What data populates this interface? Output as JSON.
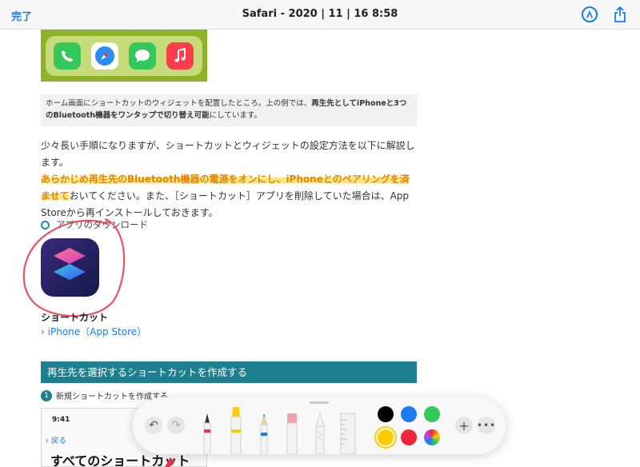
{
  "topbar": {
    "done_label": "完了",
    "title": "Safari - 2020 | 11 | 16 8:58",
    "markup_icon": "markup-pen-icon",
    "share_icon": "share-icon"
  },
  "hero": {
    "apps": [
      "phone-icon",
      "safari-icon",
      "messages-icon",
      "music-icon"
    ]
  },
  "caption": {
    "text_1": "ホーム画面にショートカットのウィジェットを配置したところ。上の例では、",
    "bold": "再生先としてiPhoneと3つのBluetooth機器をワンタップで切り替え可能",
    "text_2": "にしています。"
  },
  "article": {
    "para_1": "少々長い手順になりますが、ショートカットとウィジェットの設定方法を以下に解説します。",
    "highlight": "あらかじめ再生先のBluetooth機器の電源をオンにし、iPhoneとのペアリングを済ませて",
    "para_2": "おいてください。また、［ショートカット］アプリを削除していた場合は、App Storeから再インストールしておきます。",
    "download_label": "アプリのダウンロード",
    "app_name": "ショートカット",
    "store_link": "iPhone（App Store）",
    "section_title": "再生先を選択するショートカットを作成する",
    "step_number": "1",
    "step_text": "新規ショートカットを作成する",
    "screenshot": {
      "time": "9:41",
      "back_label": "戻る",
      "title": "すべてのショートカット"
    }
  },
  "toolbar": {
    "tools": [
      "undo-icon",
      "redo-icon",
      "pen-tool-icon",
      "highlighter-tool-icon",
      "pencil-tool-icon",
      "eraser-tool-icon",
      "lasso-tool-icon",
      "ruler-tool-icon"
    ],
    "colors": [
      "#000000",
      "#1a7cf2",
      "#34c759",
      "#ffcc00",
      "#f0243a",
      "color-wheel"
    ],
    "selected_color": "#ffcc00"
  },
  "colors": {
    "accent": "#1a7cf2",
    "section": "#1e7f91",
    "highlight": "#ffe680",
    "annotation": "#e8344a"
  }
}
